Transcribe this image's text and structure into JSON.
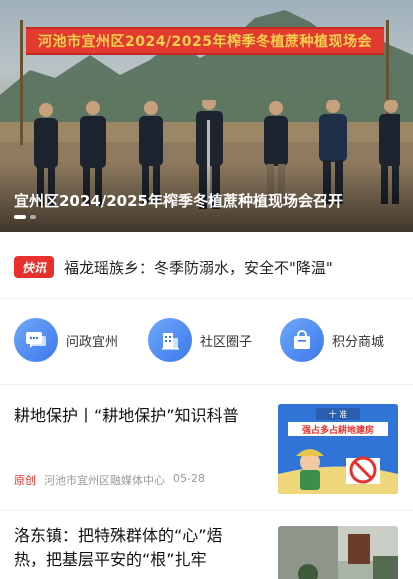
{
  "hero": {
    "banner_text": "河池市宜州区2024/2025年榨季冬植蔗种植现场会",
    "caption": "宜州区2024/2025年榨季冬植蔗种植现场会召开",
    "slide_count": 2,
    "active_slide": 1
  },
  "news_flash": {
    "badge": "快讯",
    "text": "福龙瑶族乡：冬季防溺水，安全不\"降温\""
  },
  "quick_links": [
    {
      "label": "问政宜州",
      "icon": "chat-bubble-icon"
    },
    {
      "label": "社区圈子",
      "icon": "building-icon"
    },
    {
      "label": "积分商城",
      "icon": "shopping-bag-icon"
    }
  ],
  "articles": [
    {
      "title": "耕地保护丨“耕地保护”知识科普",
      "tag": "原创",
      "source": "河池市宜州区融媒体中心",
      "date": "05-28",
      "thumb_caption": "强占多占耕地建房",
      "thumb_header": "十 准"
    },
    {
      "title": "洛东镇：把特殊群体的“心”焐热，把基层平安的“根”扎牢",
      "tag": "",
      "source": "",
      "date": ""
    }
  ],
  "colors": {
    "accent_red": "#e8302c",
    "icon_blue": "#3c78ee",
    "banner_red": "#e23a2f",
    "banner_text": "#f6d24d"
  }
}
